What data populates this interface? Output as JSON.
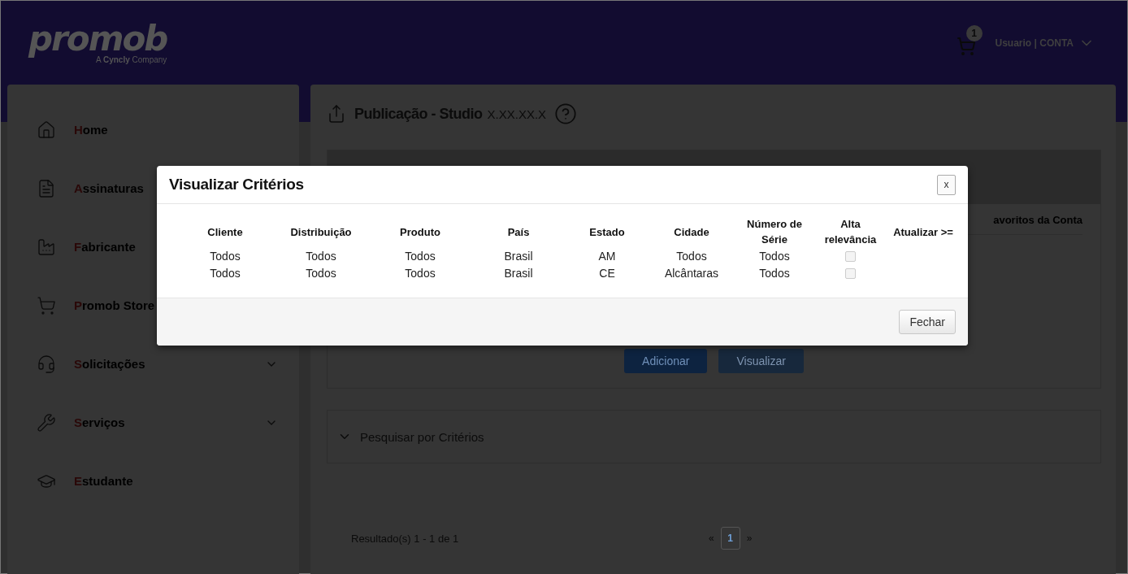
{
  "header": {
    "logo": "promob",
    "logo_tagline_prefix": "A",
    "logo_tagline_brand": "Cyncly",
    "logo_tagline_suffix": "Company",
    "cart_count": "1",
    "user": "Usuario | CONTA"
  },
  "sidebar": {
    "items": [
      {
        "label": "Home",
        "expandable": false
      },
      {
        "label": "Assinaturas"
      },
      {
        "label": "Fabricante"
      },
      {
        "label": "Promob Store"
      },
      {
        "label": "Solicitações",
        "expandable": true
      },
      {
        "label": "Serviços",
        "expandable": true
      },
      {
        "label": "Estudante",
        "expandable": false
      }
    ]
  },
  "main": {
    "title": "Publicação - Studio",
    "version": "X.XX.XX.X",
    "tab": "avoritos da Conta",
    "buttons": [
      "Adicionar",
      "Visualizar"
    ],
    "accordion": {
      "label": "Pesquisar por Critérios",
      "expanded": false
    },
    "results": "Resultado(s) 1 - 1 de 1",
    "pagination": {
      "prev": "«",
      "next": "»",
      "pages": [
        {
          "label": "1",
          "selected": true
        }
      ]
    }
  },
  "modal": {
    "title": "Visualizar Critérios",
    "close": "x",
    "columns": [
      "Cliente",
      "Distribuição",
      "Produto",
      "País",
      "Estado",
      "Cidade",
      "Número de Série",
      "Alta relevância",
      "Atualizar >="
    ],
    "rows": [
      {
        "cells": [
          "Todos",
          "Todos",
          "Todos",
          "Brasil",
          "AM",
          "Todos",
          "Todos"
        ],
        "high_relevance": false
      },
      {
        "cells": [
          "Todos",
          "Todos",
          "Todos",
          "Brasil",
          "CE",
          "Alcântaras",
          "Todos"
        ],
        "high_relevance": false
      }
    ],
    "button": "Fechar"
  }
}
